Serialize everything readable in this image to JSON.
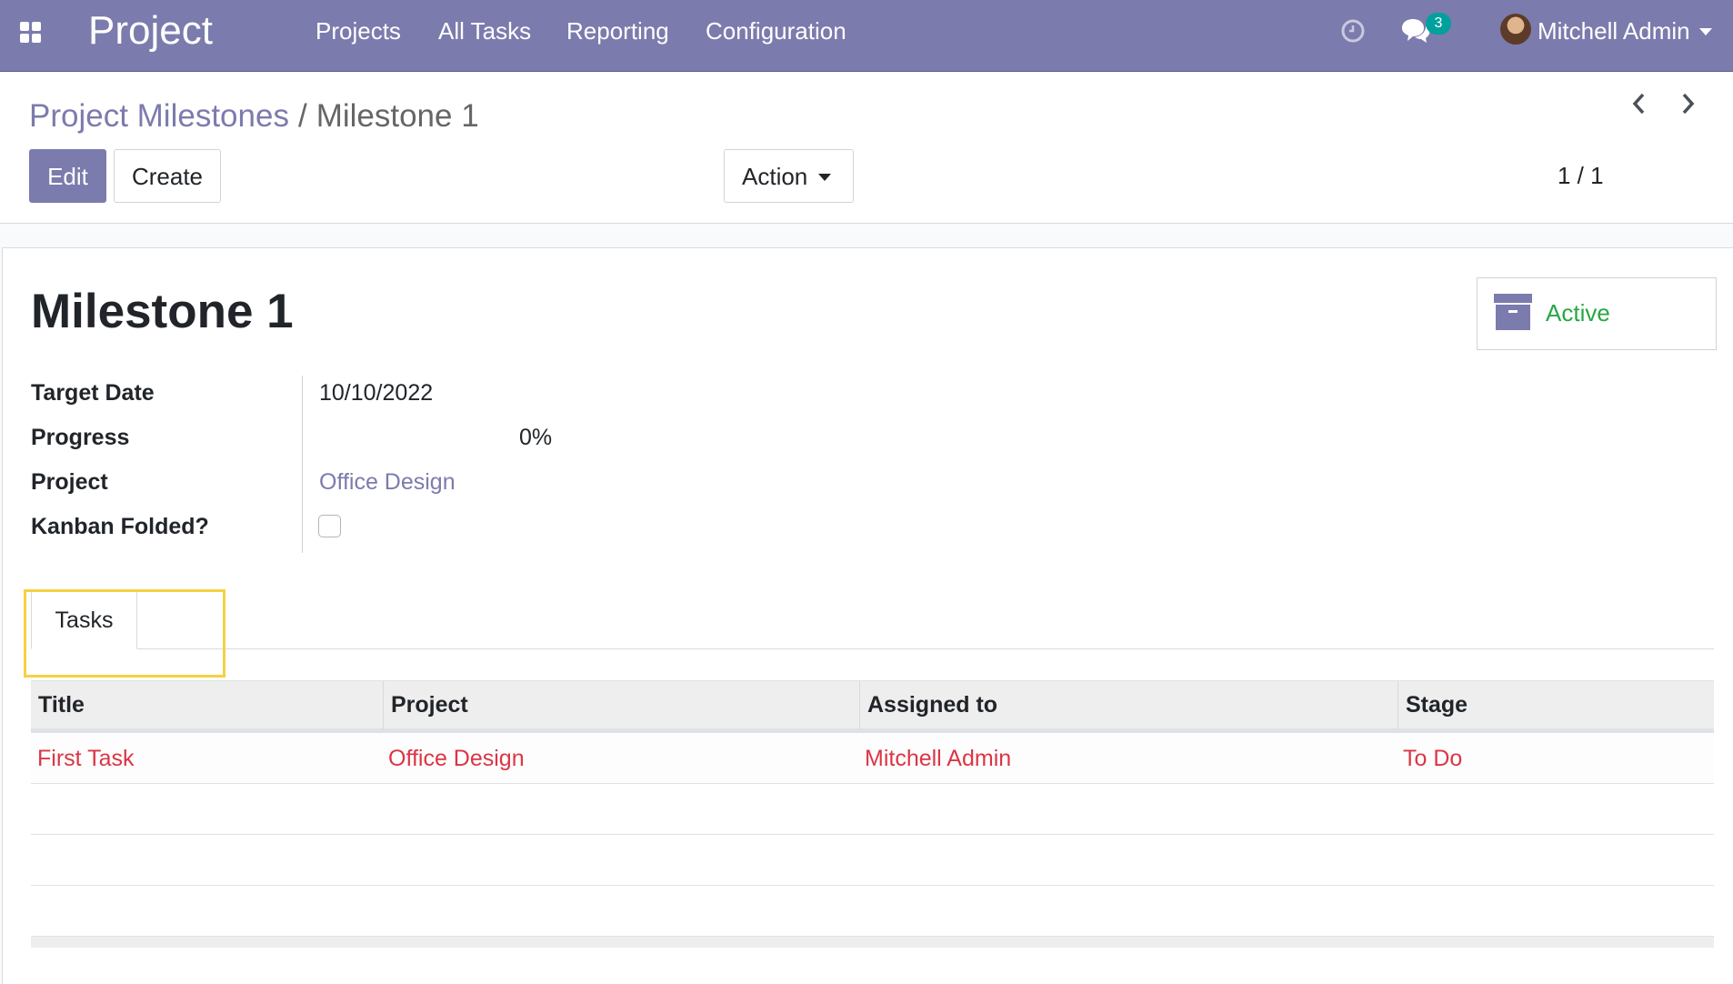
{
  "navbar": {
    "app_title": "Project",
    "menu": [
      "Projects",
      "All Tasks",
      "Reporting",
      "Configuration"
    ],
    "chat_count": "3",
    "user_name": "Mitchell Admin",
    "icons": [
      "apps-icon",
      "clock-icon",
      "chat-icon",
      "user-avatar",
      "chevron-down-icon"
    ],
    "color": "#7c7bad"
  },
  "breadcrumb": {
    "parent": "Project Milestones",
    "separator": "/",
    "current": "Milestone 1"
  },
  "toolbar": {
    "edit_label": "Edit",
    "create_label": "Create",
    "action_label": "Action",
    "pager": "1 / 1"
  },
  "record": {
    "title": "Milestone 1",
    "status_button": "Active",
    "fields": {
      "target_date_label": "Target Date",
      "target_date_value": "10/10/2022",
      "progress_label": "Progress",
      "progress_value": "0%",
      "project_label": "Project",
      "project_value": "Office Design",
      "kanban_folded_label": "Kanban Folded?",
      "kanban_folded_value": false
    }
  },
  "tabs": [
    {
      "label": "Tasks",
      "active": true
    }
  ],
  "tasks_table": {
    "columns": [
      "Title",
      "Project",
      "Assigned to",
      "Stage"
    ],
    "rows": [
      {
        "title": "First Task",
        "project": "Office Design",
        "assigned_to": "Mitchell Admin",
        "stage": "To Do"
      }
    ]
  },
  "colors": {
    "brand": "#7c7bad",
    "active_green": "#28a745",
    "row_red": "#dc3545",
    "highlight": "#f5d142"
  }
}
